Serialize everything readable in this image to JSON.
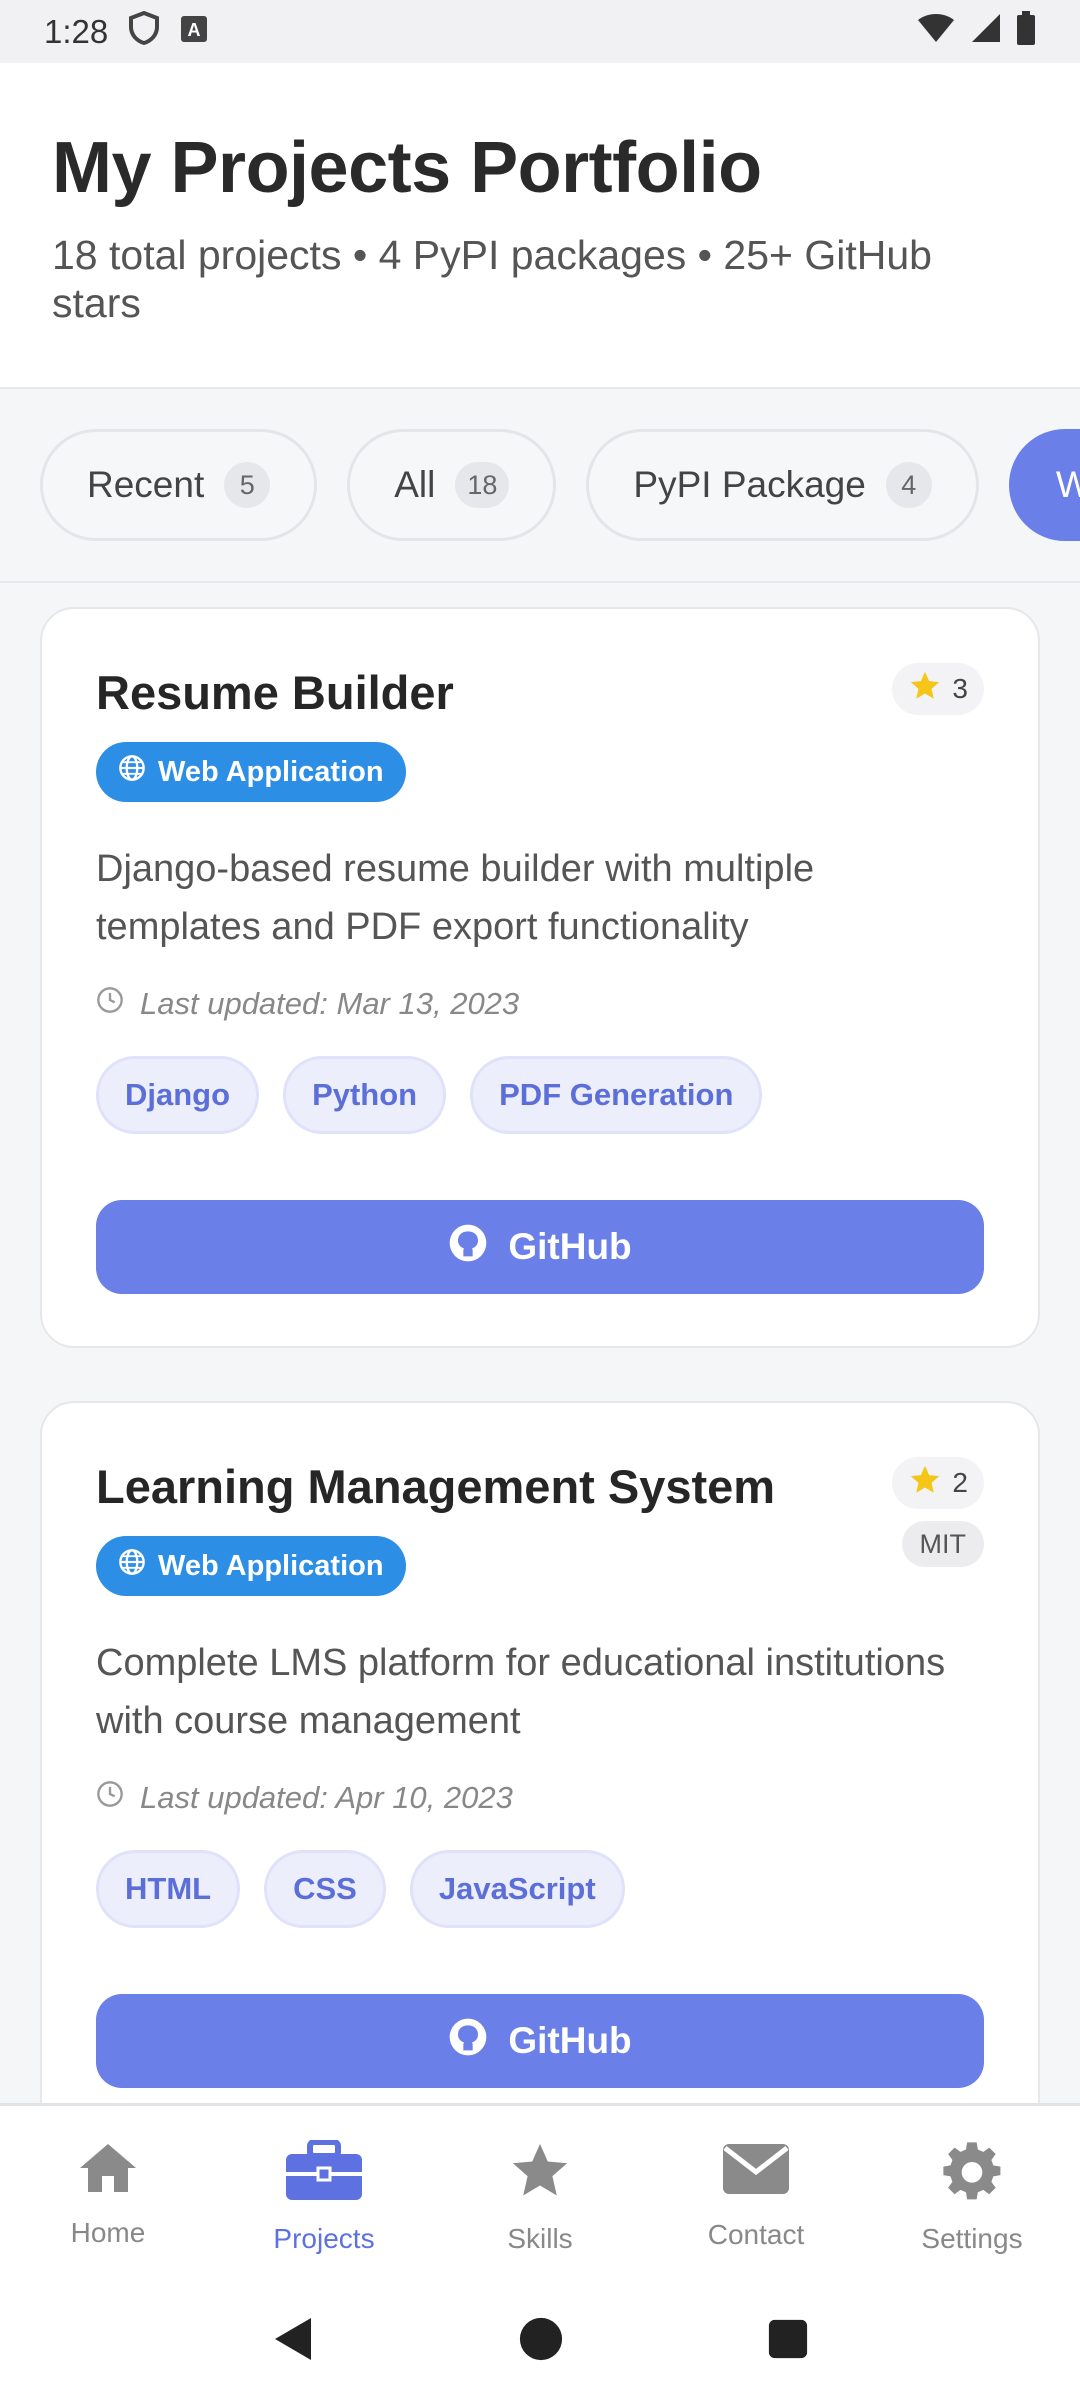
{
  "status_bar": {
    "time": "1:28"
  },
  "header": {
    "title": "My Projects Portfolio",
    "subtitle": "18 total projects • 4 PyPI packages • 25+ GitHub stars"
  },
  "filters": [
    {
      "label": "Recent",
      "count": "5"
    },
    {
      "label": "All",
      "count": "18"
    },
    {
      "label": "PyPI Package",
      "count": "4"
    },
    {
      "label": "W"
    }
  ],
  "projects": [
    {
      "title": "Resume Builder",
      "stars": "3",
      "type": "Web Application",
      "description": "Django-based resume builder with multiple templates and PDF export functionality",
      "updated": "Last updated: Mar 13, 2023",
      "tags": [
        "Django",
        "Python",
        "PDF Generation"
      ],
      "button": "GitHub"
    },
    {
      "title": "Learning Management System",
      "stars": "2",
      "license": "MIT",
      "type": "Web Application",
      "description": "Complete LMS platform for educational institutions with course management",
      "updated": "Last updated: Apr 10, 2023",
      "tags": [
        "HTML",
        "CSS",
        "JavaScript"
      ],
      "button": "GitHub"
    }
  ],
  "bottom_nav": [
    {
      "label": "Home",
      "icon": "home-icon"
    },
    {
      "label": "Projects",
      "icon": "briefcase-icon",
      "active": true
    },
    {
      "label": "Skills",
      "icon": "star-icon"
    },
    {
      "label": "Contact",
      "icon": "envelope-icon"
    },
    {
      "label": "Settings",
      "icon": "gear-icon"
    }
  ],
  "colors": {
    "accent": "#6b7fe8",
    "type_badge": "#2d8ee6",
    "star": "#f5c518"
  }
}
